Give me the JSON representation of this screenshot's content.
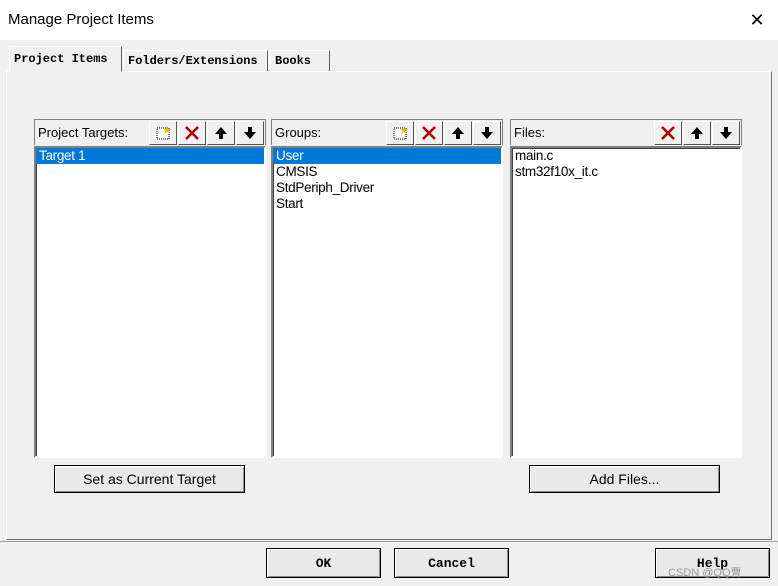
{
  "window": {
    "title": "Manage Project Items",
    "close_glyph": "✕"
  },
  "tabs": [
    {
      "label": "Project Items",
      "active": true
    },
    {
      "label": "Folders/Extensions",
      "active": false
    },
    {
      "label": "Books",
      "active": false
    }
  ],
  "targets": {
    "header": "Project Targets:",
    "items": [
      "Target 1"
    ],
    "selected_index": 0
  },
  "groups": {
    "header": "Groups:",
    "items": [
      "User",
      "CMSIS",
      "StdPeriph_Driver",
      "Start"
    ],
    "selected_index": 0
  },
  "files": {
    "header": "Files:",
    "items": [
      "main.c",
      "stm32f10x_it.c"
    ]
  },
  "buttons": {
    "set_current": "Set as Current Target",
    "add_files": "Add Files...",
    "ok": "OK",
    "cancel": "Cancel",
    "help": "Help"
  },
  "toolbar_icons": [
    "new-icon",
    "delete-icon",
    "move-up-icon",
    "move-down-icon"
  ],
  "watermark": "CSDN @QQ曹",
  "colors": {
    "selection": "#0078d7",
    "delete": "#b00000"
  }
}
